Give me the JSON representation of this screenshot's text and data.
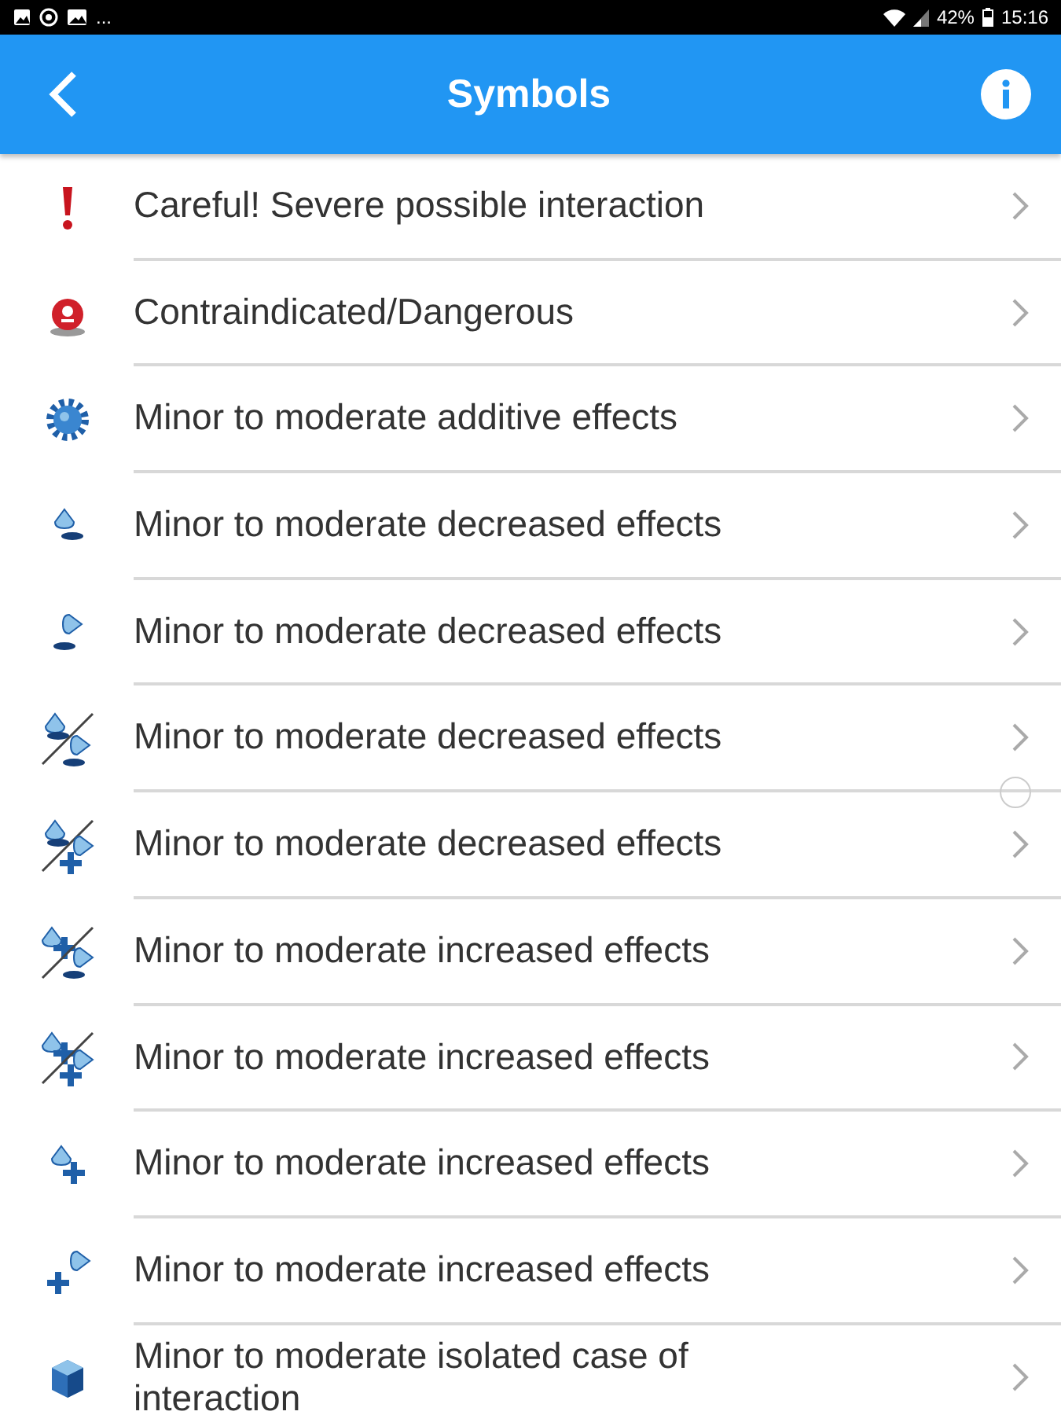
{
  "status_bar": {
    "left": "...",
    "battery": "42%",
    "time": "15:16"
  },
  "header": {
    "title": "Symbols"
  },
  "items": [
    {
      "kind": "careful",
      "label": "Careful! Severe possible interaction"
    },
    {
      "kind": "danger",
      "label": "Contraindicated/Dangerous"
    },
    {
      "kind": "additive",
      "label": "Minor to moderate additive effects"
    },
    {
      "kind": "dec-up",
      "label": "Minor to moderate decreased effects"
    },
    {
      "kind": "dec-side",
      "label": "Minor to moderate decreased effects"
    },
    {
      "kind": "dec-up-dec-side",
      "label": "Minor to moderate decreased effects"
    },
    {
      "kind": "dec-up-inc-side",
      "label": "Minor to moderate decreased effects"
    },
    {
      "kind": "inc-up-dec-side",
      "label": "Minor to moderate increased effects"
    },
    {
      "kind": "inc-up-inc-side",
      "label": "Minor to moderate increased effects"
    },
    {
      "kind": "inc-up",
      "label": "Minor to moderate increased effects"
    },
    {
      "kind": "inc-side",
      "label": "Minor to moderate increased effects"
    },
    {
      "kind": "isolated",
      "label": "Minor to moderate isolated case of interaction"
    }
  ]
}
